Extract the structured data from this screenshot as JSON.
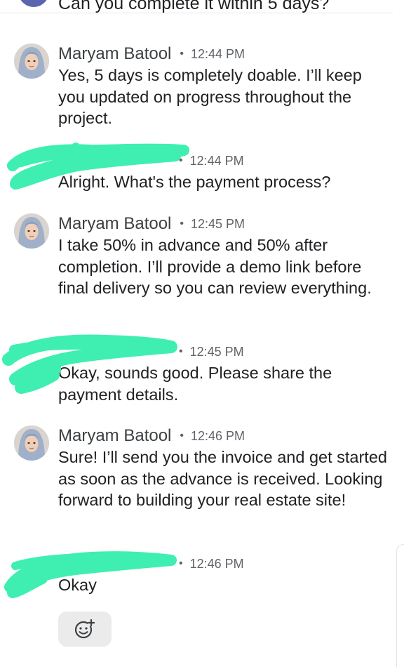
{
  "previous_message": {
    "text": "Can you complete it within 5 days?"
  },
  "messages": [
    {
      "sender": "Maryam Batool",
      "separator": "•",
      "time": "12:44 PM",
      "text": "Yes, 5 days is completely doable. I’ll keep you updated on progress throughout the project."
    },
    {
      "separator": "•",
      "time": "12:44 PM",
      "text": "Alright. What's the payment process?"
    },
    {
      "sender": "Maryam Batool",
      "separator": "•",
      "time": "12:45 PM",
      "text": "I take 50% in advance and 50% after completion. I’ll provide a demo link before final delivery so you can review everything."
    },
    {
      "separator": "•",
      "time": "12:45 PM",
      "text": "Okay, sounds good. Please share the payment details."
    },
    {
      "sender": "Maryam Batool",
      "separator": "•",
      "time": "12:46 PM",
      "text": "Sure! I’ll send you the invoice and get started as soon as the advance is received. Looking forward to building your real estate site!"
    },
    {
      "separator": "•",
      "time": "12:46 PM",
      "text": "Okay"
    }
  ],
  "icons": {
    "add_reaction": "add-reaction-icon",
    "avatar": "avatar"
  },
  "colors": {
    "redaction_mark": "#3eefb1",
    "text_primary": "#202124",
    "text_secondary": "#5f6368",
    "reaction_bg": "#ebebeb"
  }
}
